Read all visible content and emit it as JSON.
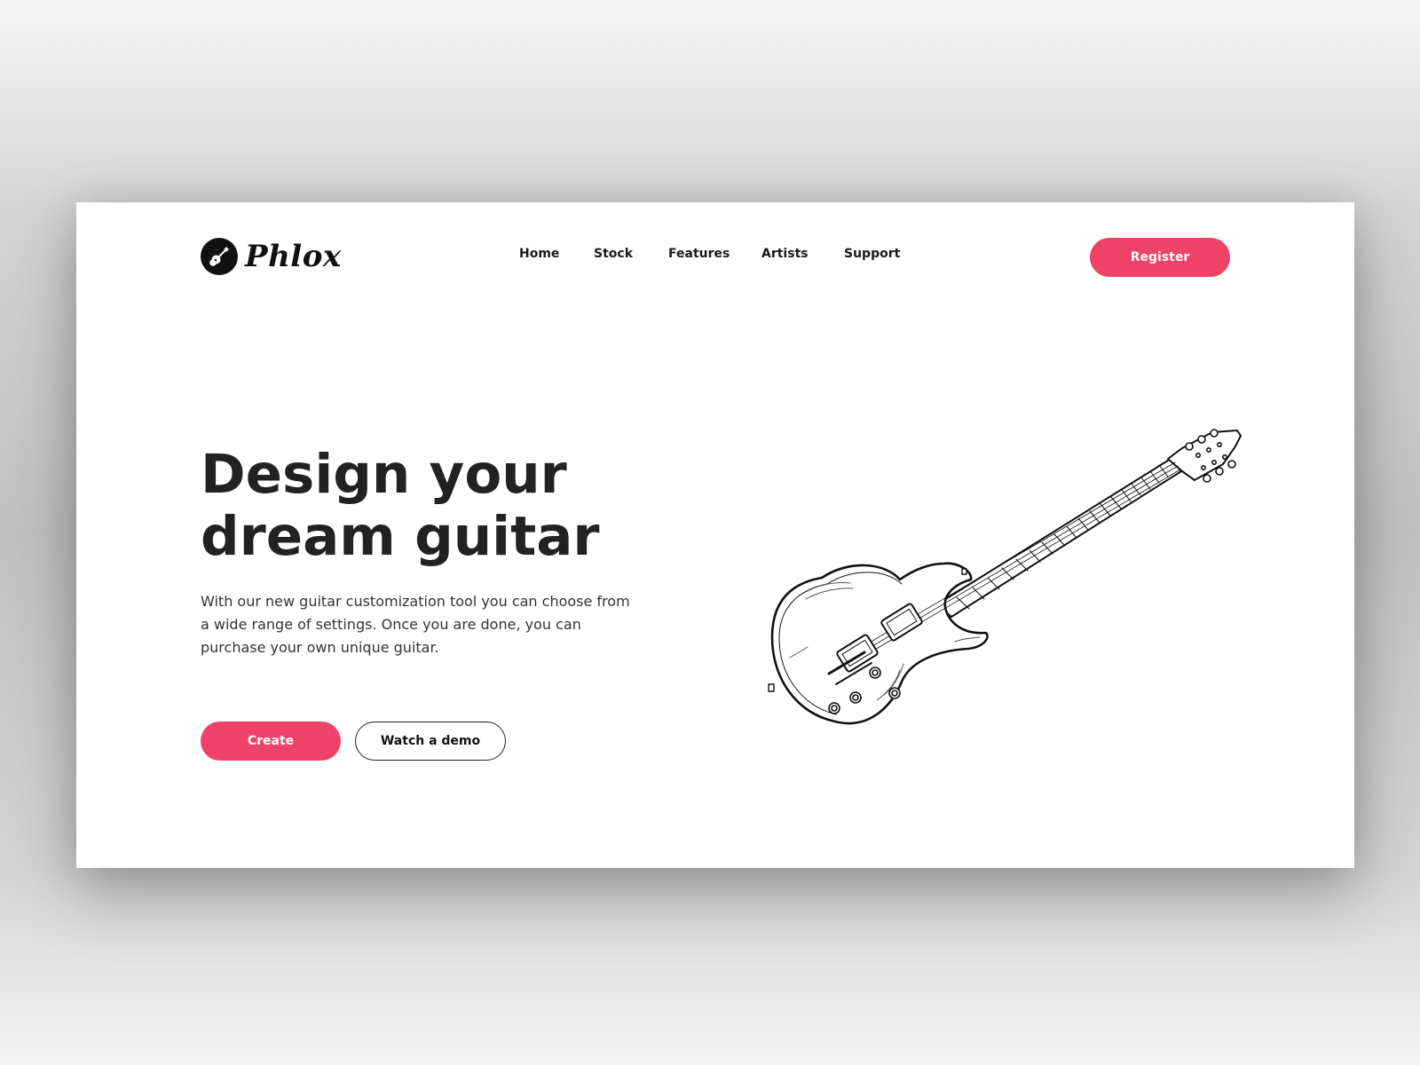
{
  "brand": {
    "name": "Phlox",
    "logo_icon": "guitar-badge-icon"
  },
  "nav": {
    "items": [
      {
        "label": "Home"
      },
      {
        "label": "Stock"
      },
      {
        "label": "Features"
      },
      {
        "label": "Artists"
      },
      {
        "label": "Support"
      }
    ],
    "register_label": "Register"
  },
  "hero": {
    "title_lines": [
      "Design your",
      "dream guitar"
    ],
    "description_lines": [
      "With our new guitar customization tool you can choose from",
      "a wide range of settings. Once you are done, you can",
      "purchase your own unique guitar."
    ],
    "primary_button": "Create",
    "secondary_button": "Watch a demo",
    "illustration": "electric-guitar-sketch"
  },
  "colors": {
    "accent": "#ef4269",
    "text": "#222222",
    "card": "#ffffff"
  }
}
